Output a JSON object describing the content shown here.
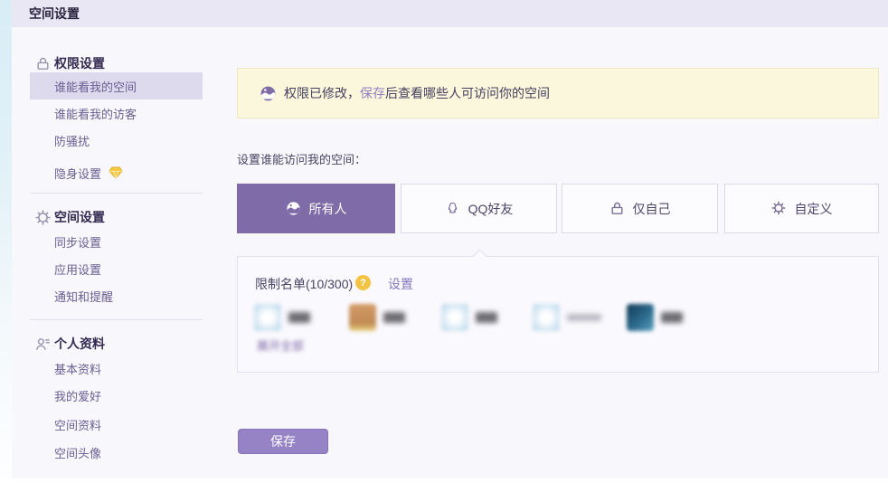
{
  "window": {
    "title": "空间设置"
  },
  "sidebar": {
    "sections": [
      {
        "icon": "lock-icon",
        "label": "权限设置",
        "items": [
          {
            "label": "谁能看我的空间",
            "active": true
          },
          {
            "label": "谁能看我的访客",
            "active": false
          },
          {
            "label": "防骚扰",
            "active": false
          },
          {
            "label": "隐身设置",
            "active": false,
            "badge": "diamond-icon"
          }
        ]
      },
      {
        "icon": "gear-icon",
        "label": "空间设置",
        "items": [
          {
            "label": "同步设置",
            "active": false
          },
          {
            "label": "应用设置",
            "active": false
          },
          {
            "label": "通知和提醒",
            "active": false
          }
        ]
      },
      {
        "icon": "person-icon",
        "label": "个人资料",
        "items": [
          {
            "label": "基本资料",
            "active": false
          },
          {
            "label": "我的爱好",
            "active": false
          },
          {
            "label": "空间资料",
            "active": false
          },
          {
            "label": "空间头像",
            "active": false
          }
        ]
      }
    ]
  },
  "main": {
    "notice": {
      "icon": "globe-icon",
      "prefix": "权限已修改，",
      "link": "保存",
      "suffix": "后查看哪些人可访问你的空间"
    },
    "section_label": "设置谁能访问我的空间：",
    "tabs": [
      {
        "label": "所有人",
        "icon": "globe-icon",
        "selected": true
      },
      {
        "label": "QQ好友",
        "icon": "qq-penguin-icon",
        "selected": false
      },
      {
        "label": "仅自己",
        "icon": "lock-icon",
        "selected": false
      },
      {
        "label": "自定义",
        "icon": "gear-icon",
        "selected": false
      }
    ],
    "restrict_panel": {
      "title": "限制名单(10/300)",
      "help_icon": "?",
      "settings_link": "设置",
      "expand_link": "展开全部",
      "members": [
        {
          "avatar_style": "light-blue",
          "name_blurred": true
        },
        {
          "avatar_style": "orange",
          "name_blurred": true
        },
        {
          "avatar_style": "light-blue",
          "name_blurred": true
        },
        {
          "avatar_style": "light-blue",
          "name_blurred": true
        },
        {
          "avatar_style": "dark-teal",
          "name_blurred": true
        }
      ]
    },
    "save_button": "保存"
  },
  "colors": {
    "accent_purple": "#7e6ba8",
    "save_button_purple": "#9583c6",
    "banner_yellow": "#fbf7dc",
    "header_lavender": "#e9e7f4",
    "sidebar_active_bg": "#dedaee",
    "help_badge_yellow": "#f3c443",
    "diamond_yellow": "#f6c93c"
  }
}
